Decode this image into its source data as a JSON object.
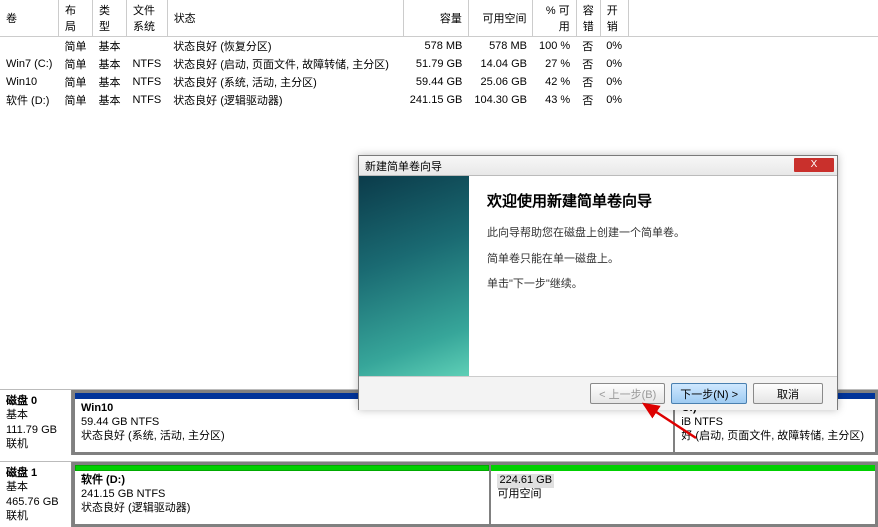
{
  "table": {
    "headers": {
      "volume": "卷",
      "layout": "布局",
      "type": "类型",
      "fs": "文件系统",
      "status": "状态",
      "capacity": "容量",
      "free": "可用空间",
      "pctfree": "% 可用",
      "fault": "容错",
      "overhead": "开销"
    },
    "rows": [
      {
        "volume": "",
        "layout": "简单",
        "type": "基本",
        "fs": "",
        "status": "状态良好 (恢复分区)",
        "capacity": "578 MB",
        "free": "578 MB",
        "pctfree": "100 %",
        "fault": "否",
        "overhead": "0%"
      },
      {
        "volume": "Win7 (C:)",
        "layout": "简单",
        "type": "基本",
        "fs": "NTFS",
        "status": "状态良好 (启动, 页面文件, 故障转储, 主分区)",
        "capacity": "51.79 GB",
        "free": "14.04 GB",
        "pctfree": "27 %",
        "fault": "否",
        "overhead": "0%"
      },
      {
        "volume": "Win10",
        "layout": "简单",
        "type": "基本",
        "fs": "NTFS",
        "status": "状态良好 (系统, 活动, 主分区)",
        "capacity": "59.44 GB",
        "free": "25.06 GB",
        "pctfree": "42 %",
        "fault": "否",
        "overhead": "0%"
      },
      {
        "volume": "软件 (D:)",
        "layout": "简单",
        "type": "基本",
        "fs": "NTFS",
        "status": "状态良好 (逻辑驱动器)",
        "capacity": "241.15 GB",
        "free": "104.30 GB",
        "pctfree": "43 %",
        "fault": "否",
        "overhead": "0%"
      }
    ]
  },
  "disks": {
    "disk0": {
      "title": "磁盘 0",
      "type": "基本",
      "size": "111.79 GB",
      "state": "联机",
      "parts": [
        {
          "label": "Win10",
          "sub": "59.44 GB NTFS",
          "status": "状态良好 (系统, 活动, 主分区)"
        },
        {
          "label": "C:)",
          "sub": "iB NTFS",
          "status": "好 (启动, 页面文件, 故障转储, 主分区)"
        }
      ]
    },
    "disk1": {
      "title": "磁盘 1",
      "type": "基本",
      "size": "465.76 GB",
      "state": "联机",
      "parts": [
        {
          "label": "软件 (D:)",
          "sub": "241.15 GB NTFS",
          "status": "状态良好 (逻辑驱动器)"
        },
        {
          "label": "",
          "sub": "224.61 GB",
          "status": "可用空间"
        }
      ]
    }
  },
  "dialog": {
    "title": "新建简单卷向导",
    "heading": "欢迎使用新建简单卷向导",
    "line1": "此向导帮助您在磁盘上创建一个简单卷。",
    "line2": "简单卷只能在单一磁盘上。",
    "line3": "单击\"下一步\"继续。",
    "buttons": {
      "back": "< 上一步(B)",
      "next": "下一步(N) >",
      "cancel": "取消",
      "close": "X"
    }
  }
}
